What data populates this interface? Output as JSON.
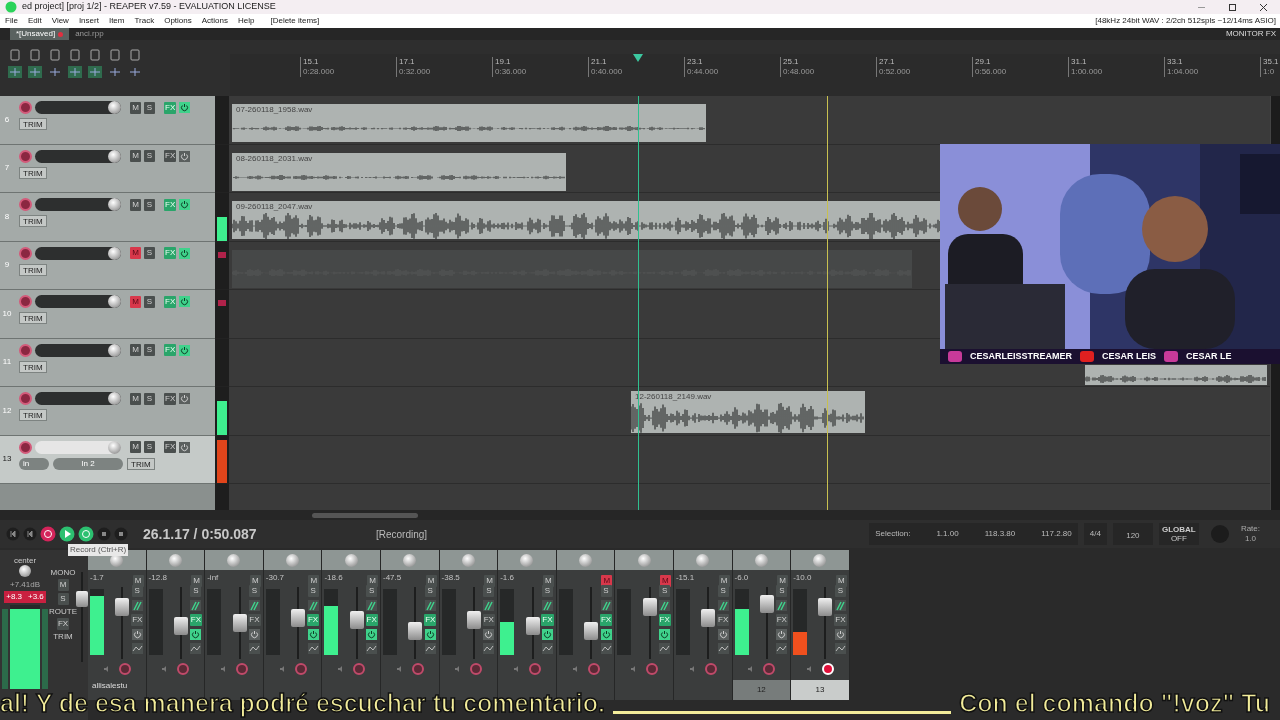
{
  "title_bar": {
    "title": "ed project] [proj 1/2] - REAPER v7.59 - EVALUATION LICENSE"
  },
  "menu": [
    {
      "label": "File"
    },
    {
      "label": "Edit"
    },
    {
      "label": "View"
    },
    {
      "label": "Insert"
    },
    {
      "label": "Item"
    },
    {
      "label": "Track"
    },
    {
      "label": "Options"
    },
    {
      "label": "Actions"
    },
    {
      "label": "Help"
    }
  ],
  "last_action": "[Delete items]",
  "audio_status": "[48kHz 24bit WAV : 2/2ch 512spls ~12/14ms ASIO]",
  "project_tabs": [
    {
      "label": "*[Unsaved]",
      "selected": true
    },
    {
      "label": "anci.rpp",
      "selected": false
    }
  ],
  "monitor_fx": "MONITOR FX",
  "ruler": [
    {
      "bar": "15.1",
      "time": "0:28.000"
    },
    {
      "bar": "17.1",
      "time": "0:32.000"
    },
    {
      "bar": "19.1",
      "time": "0:36.000"
    },
    {
      "bar": "21.1",
      "time": "0:40.000"
    },
    {
      "bar": "23.1",
      "time": "0:44.000"
    },
    {
      "bar": "25.1",
      "time": "0:48.000"
    },
    {
      "bar": "27.1",
      "time": "0:52.000"
    },
    {
      "bar": "29.1",
      "time": "0:56.000"
    },
    {
      "bar": "31.1",
      "time": "1:00.000"
    },
    {
      "bar": "33.1",
      "time": "1:04.000"
    },
    {
      "bar": "35.1",
      "time": "1:0"
    }
  ],
  "tracks": [
    {
      "number": "6",
      "selected": false,
      "muted": false,
      "fx_on": true,
      "mute_label": "M",
      "solo_label": "S",
      "fx_label": "FX",
      "trim_label": "TRIM",
      "clip": {
        "label": "07-260118_1958.wav",
        "muted": false
      }
    },
    {
      "number": "7",
      "selected": false,
      "muted": false,
      "fx_on": false,
      "mute_label": "M",
      "solo_label": "S",
      "fx_label": "FX",
      "trim_label": "TRIM",
      "clip": {
        "label": "08-260118_2031.wav",
        "muted": false
      }
    },
    {
      "number": "8",
      "selected": false,
      "muted": false,
      "fx_on": true,
      "mute_label": "M",
      "solo_label": "S",
      "fx_label": "FX",
      "trim_label": "TRIM",
      "meter": {
        "level": 0.5
      },
      "clip": {
        "label": "09-260118_2047.wav",
        "muted": false
      }
    },
    {
      "number": "9",
      "selected": false,
      "muted": true,
      "fx_on": true,
      "mute_label": "M",
      "solo_label": "S",
      "fx_label": "FX",
      "trim_label": "TRIM",
      "clip": {
        "muted": true
      }
    },
    {
      "number": "10",
      "selected": false,
      "muted": true,
      "fx_on": true,
      "mute_label": "M",
      "solo_label": "S",
      "fx_label": "FX",
      "trim_label": "TRIM"
    },
    {
      "number": "11",
      "selected": false,
      "muted": false,
      "fx_on": true,
      "mute_label": "M",
      "solo_label": "S",
      "fx_label": "FX",
      "trim_label": "TRIM",
      "clip": {
        "muted": false
      }
    },
    {
      "number": "12",
      "selected": false,
      "muted": false,
      "fx_on": false,
      "mute_label": "M",
      "solo_label": "S",
      "fx_label": "FX",
      "trim_label": "TRIM",
      "meter": {
        "level": 0.7
      },
      "clip": {
        "label": "12-260118_2149.wav",
        "muted": false
      }
    },
    {
      "number": "13",
      "selected": true,
      "muted": false,
      "fx_on": false,
      "mute_label": "M",
      "solo_label": "S",
      "fx_label": "FX",
      "trim_label": "TRIM",
      "meter": {
        "level": 0.9
      },
      "input": "in",
      "input_name": "In 2"
    }
  ],
  "webcam": {
    "labels": [
      "CESARLEISSTREAMER",
      "CESAR LEIS",
      "CESAR LE"
    ]
  },
  "transport": {
    "recording": true,
    "time": "26.1.17 / 0:50.087",
    "status": "[Recording]",
    "tooltip": "Record (Ctrl+R)",
    "selection_label": "Selection:",
    "start": "1.1.00",
    "end": "118.3.80",
    "length": "117.2.80",
    "time_signature": "4/4",
    "tempo": "120",
    "automation": "GLOBAL",
    "automation_state": "OFF",
    "rate_label": "Rate:",
    "rate": "1.0"
  },
  "master": {
    "pan_label": "center",
    "db": "+7.41dB",
    "peak_left": "+8.3",
    "peak_right": "+3.6",
    "mono_label": "MONO",
    "mute_label": "M",
    "solo_label": "S",
    "route_label": "ROUTE",
    "fx_label": "FX",
    "trim_label": "TRIM",
    "meter": {
      "level": 0.95
    },
    "fader": {
      "level": 0.75
    }
  },
  "mixer_label": "allisalestu",
  "strips": [
    {
      "db": "-1.7",
      "muted": false,
      "fx_on": false,
      "armed": false,
      "mute_label": "M",
      "solo_label": "S",
      "fx_label": "FX",
      "fader": {
        "level": 0.8
      },
      "meter": {
        "level": 0.9
      }
    },
    {
      "db": "-12.8",
      "muted": false,
      "fx_on": true,
      "armed": false,
      "mute_label": "M",
      "solo_label": "S",
      "fx_label": "FX",
      "fader": {
        "level": 0.45
      }
    },
    {
      "db": "-inf",
      "muted": false,
      "fx_on": false,
      "armed": false,
      "mute_label": "M",
      "solo_label": "S",
      "fx_label": "FX",
      "fader": {
        "level": 0.5
      }
    },
    {
      "db": "-30.7",
      "muted": false,
      "fx_on": true,
      "armed": false,
      "mute_label": "M",
      "solo_label": "S",
      "fx_label": "FX",
      "fader": {
        "level": 0.6
      }
    },
    {
      "db": "-18.6",
      "muted": false,
      "fx_on": true,
      "armed": false,
      "mute_label": "M",
      "solo_label": "S",
      "fx_label": "FX",
      "fader": {
        "level": 0.55
      },
      "meter": {
        "level": 0.75
      }
    },
    {
      "db": "-47.5",
      "muted": false,
      "fx_on": true,
      "armed": false,
      "mute_label": "M",
      "solo_label": "S",
      "fx_label": "FX",
      "fader": {
        "level": 0.35
      }
    },
    {
      "db": "-38.5",
      "muted": false,
      "fx_on": false,
      "armed": false,
      "mute_label": "M",
      "solo_label": "S",
      "fx_label": "FX",
      "fader": {
        "level": 0.55
      }
    },
    {
      "db": "-1.6",
      "muted": false,
      "fx_on": true,
      "armed": false,
      "mute_label": "M",
      "solo_label": "S",
      "fx_label": "FX",
      "fader": {
        "level": 0.45
      },
      "meter": {
        "level": 0.5
      }
    },
    {
      "muted": true,
      "fx_on": true,
      "armed": false,
      "mute_label": "M",
      "solo_label": "S",
      "fx_label": "FX",
      "fader": {
        "level": 0.35
      }
    },
    {
      "muted": true,
      "fx_on": true,
      "armed": false,
      "mute_label": "M",
      "solo_label": "S",
      "fx_label": "FX",
      "fader": {
        "level": 0.8
      }
    },
    {
      "db": "-15.1",
      "muted": false,
      "fx_on": false,
      "armed": false,
      "mute_label": "M",
      "solo_label": "S",
      "fx_label": "FX",
      "fader": {
        "level": 0.6
      }
    },
    {
      "db": "-6.0",
      "muted": false,
      "fx_on": false,
      "armed": false,
      "mute_label": "M",
      "solo_label": "S",
      "fx_label": "FX",
      "fader": {
        "level": 0.85
      },
      "meter": {
        "level": 0.7
      },
      "number": "12"
    },
    {
      "db": "-10.0",
      "muted": false,
      "fx_on": false,
      "armed": true,
      "mute_label": "M",
      "solo_label": "S",
      "fx_label": "FX",
      "fader": {
        "level": 0.8
      },
      "meter": {
        "level": 0.35
      },
      "number": "13"
    }
  ],
  "subtitles": [
    "al!  Y de esa manera podré escuchar tu comentario.",
    "Con el comando \"!voz\" Tu"
  ]
}
